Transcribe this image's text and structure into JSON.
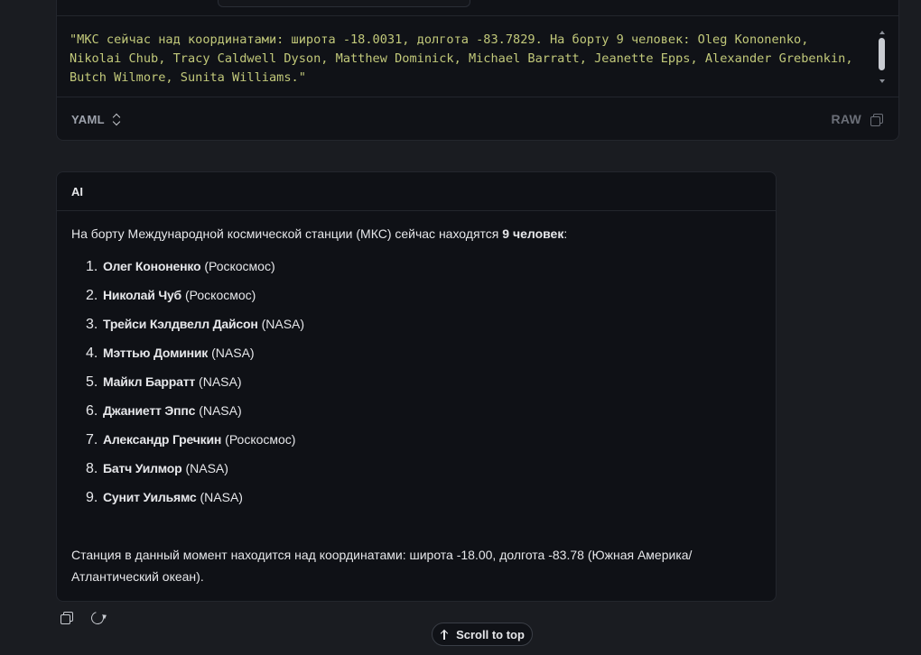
{
  "tool_output": {
    "code_lines": [
      "\"МКС сейчас над координатами: широта -18.0031, долгота -83.7829. На борту 9 человек: Oleg Kononenko,",
      "Nikolai Chub, Tracy Caldwell Dyson, Matthew Dominick, Michael Barratt, Jeanette Epps, Alexander Grebenkin,",
      "Butch Wilmore, Sunita Williams.\""
    ],
    "language": "YAML",
    "raw_label": "RAW"
  },
  "ai_message": {
    "sender": "AI",
    "intro_text": "На борту Международной космической станции (МКС) сейчас находятся ",
    "intro_bold": "9 человек",
    "intro_end": ":",
    "crew": [
      {
        "num": "1.",
        "name": "Олег Кононенко",
        "agency": "(Роскосмос)"
      },
      {
        "num": "2.",
        "name": "Николай Чуб",
        "agency": "(Роскосмос)"
      },
      {
        "num": "3.",
        "name": "Трейси Кэлдвелл Дайсон",
        "agency": "(NASA)"
      },
      {
        "num": "4.",
        "name": "Мэттью Доминик",
        "agency": "(NASA)"
      },
      {
        "num": "5.",
        "name": "Майкл Барратт",
        "agency": "(NASA)"
      },
      {
        "num": "6.",
        "name": "Джаниетт Эппс",
        "agency": "(NASA)"
      },
      {
        "num": "7.",
        "name": "Александр Гречкин",
        "agency": "(Роскосмос)"
      },
      {
        "num": "8.",
        "name": "Батч Уилмор",
        "agency": "(NASA)"
      },
      {
        "num": "9.",
        "name": "Сунит Уильямс",
        "agency": "(NASA)"
      }
    ],
    "summary": "Станция в данный момент находится над координатами: широта -18.00, долгота -83.78 (Южная Америка/ Атлантический океан)."
  },
  "actions": {
    "scroll_top_label": "Scroll to top"
  }
}
